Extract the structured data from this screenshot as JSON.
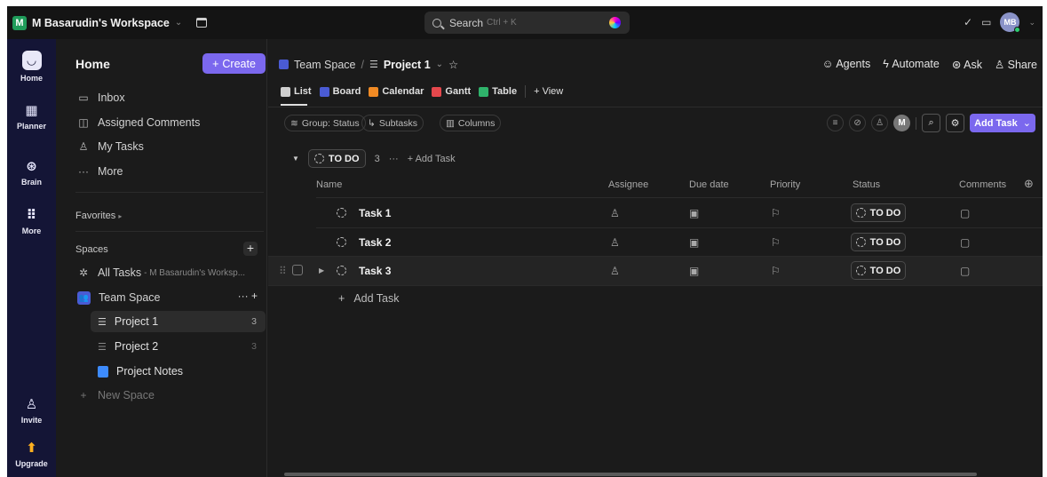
{
  "topbar": {
    "workspace_badge": "M",
    "workspace_name": "M Basarudin's Workspace",
    "search_placeholder": "Search",
    "search_shortcut": "Ctrl + K",
    "avatar_initials": "MB"
  },
  "rail": {
    "items": [
      {
        "label": "Home",
        "icon": "home-icon"
      },
      {
        "label": "Planner",
        "icon": "calendar-icon"
      },
      {
        "label": "Brain",
        "icon": "brain-icon"
      },
      {
        "label": "More",
        "icon": "grid-icon"
      },
      {
        "label": "Invite",
        "icon": "user-plus-icon"
      },
      {
        "label": "Upgrade",
        "icon": "upgrade-icon"
      }
    ]
  },
  "sidebar": {
    "title": "Home",
    "create_label": "Create",
    "nav": [
      {
        "label": "Inbox",
        "icon": "inbox-icon"
      },
      {
        "label": "Assigned Comments",
        "icon": "comment-icon"
      },
      {
        "label": "My Tasks",
        "icon": "user-icon"
      },
      {
        "label": "More",
        "icon": "ellipsis-icon"
      }
    ],
    "favorites_label": "Favorites",
    "spaces_label": "Spaces",
    "all_tasks_label": "All Tasks",
    "all_tasks_sub": "- M Basarudin's Worksp...",
    "team_space_label": "Team Space",
    "team_space_badge": "👥",
    "projects": [
      {
        "label": "Project 1",
        "count": "3"
      },
      {
        "label": "Project 2",
        "count": "3"
      }
    ],
    "project_notes_label": "Project Notes",
    "new_space_label": "New Space"
  },
  "main": {
    "breadcrumb": {
      "space": "Team Space",
      "sep": "/",
      "project": "Project 1"
    },
    "actions": [
      "Agents",
      "Automate",
      "Ask",
      "Share"
    ],
    "views": [
      {
        "label": "List",
        "color": "#cfcfcf"
      },
      {
        "label": "Board",
        "color": "#4a5bd4"
      },
      {
        "label": "Calendar",
        "color": "#f08a24"
      },
      {
        "label": "Gantt",
        "color": "#e5484d"
      },
      {
        "label": "Table",
        "color": "#2fb36b"
      }
    ],
    "add_view_label": "View",
    "chips": {
      "group": "Group: Status",
      "subtasks": "Subtasks",
      "columns": "Columns"
    },
    "add_task_button": "Add Task",
    "member_avatar": "M",
    "group": {
      "status": "TO DO",
      "count": "3",
      "add_task": "Add Task"
    },
    "columns": {
      "name": "Name",
      "assignee": "Assignee",
      "due": "Due date",
      "priority": "Priority",
      "status": "Status",
      "comments": "Comments"
    },
    "tasks": [
      {
        "name": "Task 1",
        "status": "TO DO"
      },
      {
        "name": "Task 2",
        "status": "TO DO"
      },
      {
        "name": "Task 3",
        "status": "TO DO"
      }
    ],
    "add_task_row": "Add Task"
  }
}
